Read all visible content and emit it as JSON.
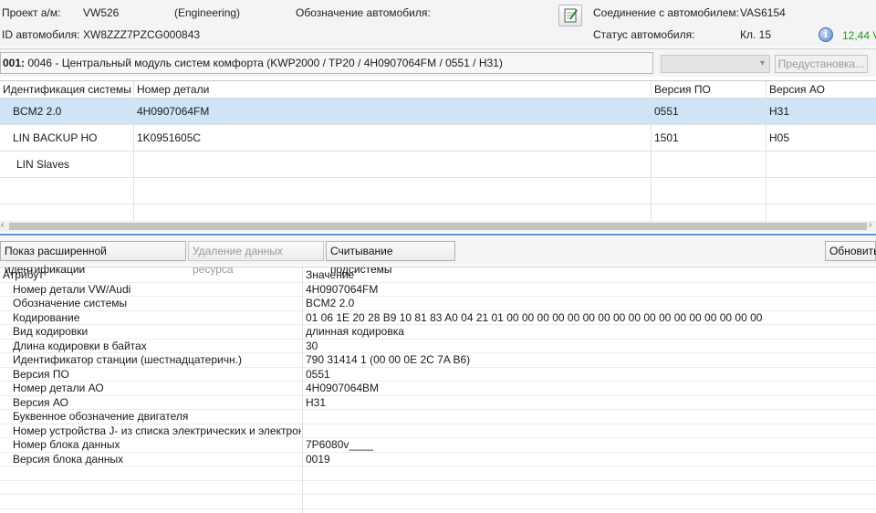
{
  "header": {
    "project_label": "Проект а/м:",
    "project_value": "VW526",
    "project_mode": "(Engineering)",
    "vehicle_designation_label": "Обозначение автомобиля:",
    "connection_label": "Соединение с автомобилем:",
    "connection_value": "VAS6154",
    "vin_label": "ID автомобиля:",
    "vin_value": "XW8ZZZ7PZCG000843",
    "status_label": "Статус автомобиля:",
    "status_value": "Кл. 15",
    "voltage": "12,44 V",
    "edit_icon": "edit-note-icon",
    "info_icon": "info-icon"
  },
  "module": {
    "address": "001:",
    "description": "0046 - Центральный модуль систем комфорта  (KWP2000 / TP20 / 4H0907064FM / 0551 / H31)",
    "select_value": "",
    "preset_button": "Предустановка..."
  },
  "systems_table": {
    "columns": [
      "Идентификация системы",
      "Номер детали",
      "Версия ПО",
      "Версия АО"
    ],
    "rows": [
      [
        "BCM2 2.0",
        "4H0907064FM",
        "0551",
        "H31"
      ],
      [
        "LIN BACKUP HO",
        "1K0951605C",
        "1501",
        "H05"
      ],
      [
        "LIN Slaves",
        "",
        "",
        ""
      ],
      [
        "",
        "",
        "",
        ""
      ],
      [
        "",
        "",
        "",
        ""
      ]
    ]
  },
  "buttons": {
    "extended_id": "Показ расширенной идентификации",
    "delete_resource": "Удаление данных ресурса",
    "read_subsystem": "Считывание подсистемы",
    "refresh": "Обновить"
  },
  "attributes_table": {
    "columns": [
      "Атрибут",
      "Значение"
    ],
    "rows": [
      [
        "Номер детали VW/Audi",
        "4H0907064FM"
      ],
      [
        "Обозначение системы",
        "BCM2 2.0"
      ],
      [
        "Кодирование",
        "01 06 1E 20 28 B9 10 81 83 A0 04 21 01 00 00 00 00 00 00 00 00 00 00 00 00 00 00 00 00 00"
      ],
      [
        "Вид кодировки",
        "длинная кодировка"
      ],
      [
        "Длина кодировки в байтах",
        "30"
      ],
      [
        "Идентификатор станции (шестнадцатеричн.)",
        "790 31414 1 (00 00 0E 2C 7A B6)"
      ],
      [
        "Версия ПО",
        "0551"
      ],
      [
        "Номер детали АО",
        "4H0907064BM"
      ],
      [
        "Версия АО",
        "H31"
      ],
      [
        "Буквенное обозначение двигателя",
        ""
      ],
      [
        "Номер устройства J- из списка электрических и электронных",
        ""
      ],
      [
        "Номер блока данных",
        "7P6080v____"
      ],
      [
        "Версия блока данных",
        "0019"
      ],
      [
        "",
        ""
      ],
      [
        "",
        ""
      ],
      [
        "",
        ""
      ],
      [
        "",
        ""
      ]
    ]
  }
}
